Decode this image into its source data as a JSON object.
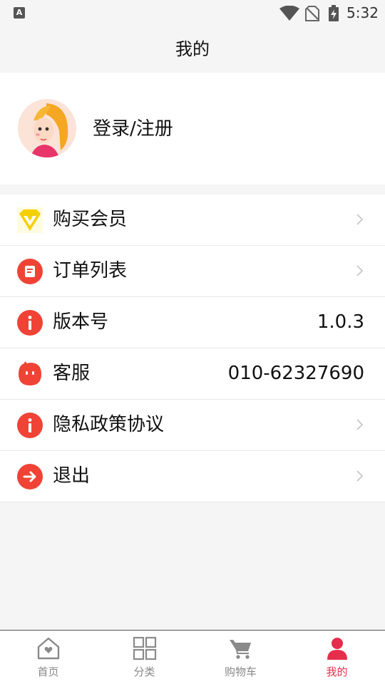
{
  "status_bar": {
    "time": "5:32",
    "notification_icon": "A"
  },
  "header": {
    "title": "我的"
  },
  "profile": {
    "login_label": "登录/注册"
  },
  "menu": [
    {
      "label": "购买会员",
      "icon": "diamond-icon",
      "value": ""
    },
    {
      "label": "订单列表",
      "icon": "order-list-icon",
      "value": ""
    },
    {
      "label": "版本号",
      "icon": "info-icon",
      "value": "1.0.3"
    },
    {
      "label": "客服",
      "icon": "customer-service-icon",
      "value": "010-62327690"
    },
    {
      "label": "隐私政策协议",
      "icon": "info-icon",
      "value": ""
    },
    {
      "label": "退出",
      "icon": "logout-arrow-icon",
      "value": ""
    }
  ],
  "tab_bar": [
    {
      "label": "首页",
      "icon": "home-icon",
      "active": false
    },
    {
      "label": "分类",
      "icon": "category-grid-icon",
      "active": false
    },
    {
      "label": "购物车",
      "icon": "cart-icon",
      "active": false
    },
    {
      "label": "我的",
      "icon": "person-icon",
      "active": true
    }
  ],
  "colors": {
    "accent": "#e52e4b",
    "icon_red": "#f04336",
    "diamond_yellow": "#f5d000",
    "background": "#f5f5f5"
  }
}
